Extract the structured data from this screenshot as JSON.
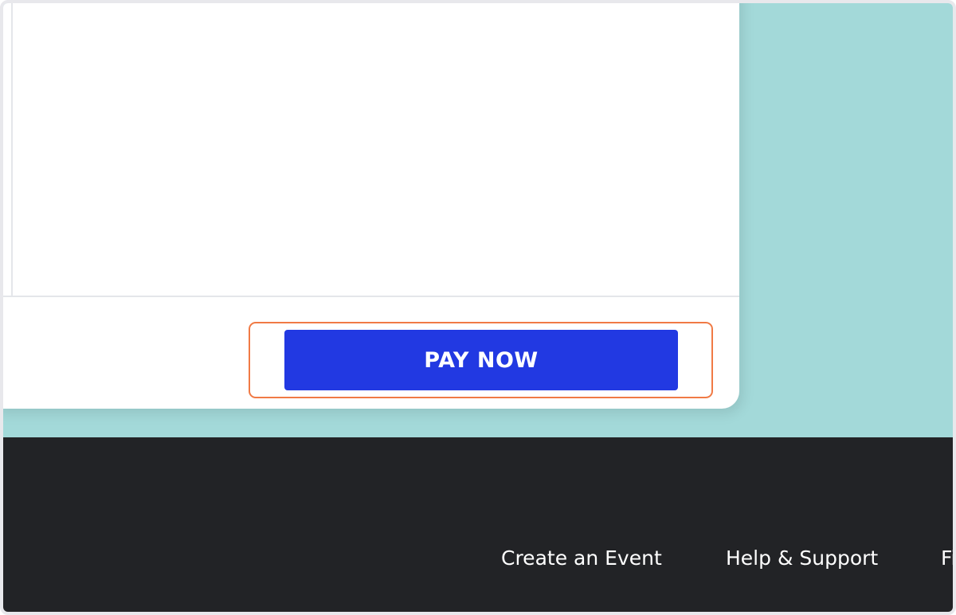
{
  "checkout": {
    "pay_button_label": "PAY NOW"
  },
  "footer": {
    "links": [
      {
        "label": "Create an Event"
      },
      {
        "label": "Help & Support"
      },
      {
        "label": "Fi"
      }
    ]
  },
  "colors": {
    "page_background": "#a3d9d9",
    "card_background": "#ffffff",
    "pay_button": "#2239e2",
    "highlight_outline": "#f07a45",
    "footer_background": "#222326",
    "footer_text": "#ffffff"
  }
}
